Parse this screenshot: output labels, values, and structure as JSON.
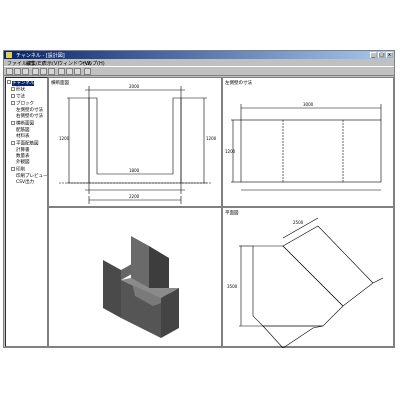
{
  "window": {
    "title": "チャンネル - [設計図]",
    "min_label": "_",
    "max_label": "□",
    "close_label": "x"
  },
  "menu": [
    "ファイル(F)",
    "編集(E)",
    "表示(V)",
    "ウィンドウ(W)",
    "ヘルプ(H)"
  ],
  "toolbar": {
    "buttons": [
      "new-icon",
      "open-icon",
      "save-icon",
      "print-icon",
      "copy-icon",
      "paste-icon",
      "view-icon",
      "zoom-icon",
      "grid-icon",
      "help-icon",
      "settings-icon",
      "info-icon"
    ]
  },
  "tree": [
    {
      "label": "チャンネル",
      "indent": 0,
      "selected": true
    },
    {
      "label": "形状",
      "indent": 1
    },
    {
      "label": "寸法",
      "indent": 1
    },
    {
      "label": "ブロック",
      "indent": 1
    },
    {
      "label": "左側壁の寸法",
      "indent": 2
    },
    {
      "label": "右側壁の寸法",
      "indent": 2
    },
    {
      "label": "横断面図",
      "indent": 1
    },
    {
      "label": "配筋図",
      "indent": 2
    },
    {
      "label": "材料表",
      "indent": 2
    },
    {
      "label": "平面配筋図",
      "indent": 1
    },
    {
      "label": "計算書",
      "indent": 2
    },
    {
      "label": "数量表",
      "indent": 2
    },
    {
      "label": "外観図",
      "indent": 2
    },
    {
      "label": "印刷",
      "indent": 1
    },
    {
      "label": "印刷プレビュー",
      "indent": 2
    },
    {
      "label": "CSV出力",
      "indent": 2
    }
  ],
  "panes": {
    "top_left": "横断面図",
    "top_right": "左側壁の寸法",
    "bottom_right": "平面図"
  },
  "dims": {
    "tl_width": "2000",
    "tl_inner": "1800",
    "tl_left_h": "1200",
    "tl_right_h": "1200",
    "tl_base": "2200",
    "tr_len": "3000",
    "tr_h": "1200",
    "br_a": "3500",
    "br_b": "2500"
  }
}
